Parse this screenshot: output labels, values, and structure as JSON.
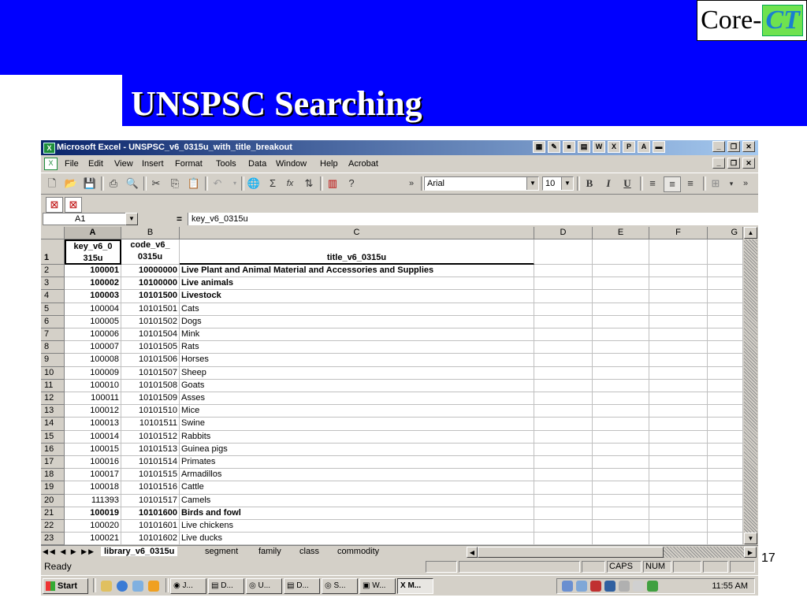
{
  "slide": {
    "title": "UNSPSC Searching",
    "logo_prefix": "Core-",
    "logo_suffix": "CT",
    "page_number": "17",
    "colors": {
      "background": "#0000ff",
      "title": "#ffffff"
    }
  },
  "window": {
    "title": "Microsoft Excel - UNSPSC_v6_0315u_with_title_breakout"
  },
  "menu": [
    "File",
    "Edit",
    "View",
    "Insert",
    "Format",
    "Tools",
    "Data",
    "Window",
    "Help",
    "Acrobat"
  ],
  "toolbar": {
    "font_name": "Arial",
    "font_size": "10",
    "bold": "B",
    "italic": "I",
    "underline": "U",
    "sigma": "Σ",
    "fx": "fx"
  },
  "formula_bar": {
    "name_box": "A1",
    "equals": "=",
    "value": "key_v6_0315u"
  },
  "columns": [
    "A",
    "B",
    "C",
    "D",
    "E",
    "F",
    "G"
  ],
  "header_row": {
    "row": "1",
    "a_line1": "key_v6_0",
    "a_line2": "315u",
    "b_line1": "code_v6_",
    "b_line2": "0315u",
    "c": "title_v6_0315u"
  },
  "rows": [
    {
      "row": "2",
      "key": "100001",
      "code": "10000000",
      "title": "Live Plant and Animal Material and Accessories and Supplies",
      "bold": true
    },
    {
      "row": "3",
      "key": "100002",
      "code": "10100000",
      "title": "Live animals",
      "bold": true
    },
    {
      "row": "4",
      "key": "100003",
      "code": "10101500",
      "title": "Livestock",
      "bold": true
    },
    {
      "row": "5",
      "key": "100004",
      "code": "10101501",
      "title": "Cats",
      "bold": false
    },
    {
      "row": "6",
      "key": "100005",
      "code": "10101502",
      "title": "Dogs",
      "bold": false
    },
    {
      "row": "7",
      "key": "100006",
      "code": "10101504",
      "title": "Mink",
      "bold": false
    },
    {
      "row": "8",
      "key": "100007",
      "code": "10101505",
      "title": "Rats",
      "bold": false
    },
    {
      "row": "9",
      "key": "100008",
      "code": "10101506",
      "title": "Horses",
      "bold": false
    },
    {
      "row": "10",
      "key": "100009",
      "code": "10101507",
      "title": "Sheep",
      "bold": false
    },
    {
      "row": "11",
      "key": "100010",
      "code": "10101508",
      "title": "Goats",
      "bold": false
    },
    {
      "row": "12",
      "key": "100011",
      "code": "10101509",
      "title": "Asses",
      "bold": false
    },
    {
      "row": "13",
      "key": "100012",
      "code": "10101510",
      "title": "Mice",
      "bold": false
    },
    {
      "row": "14",
      "key": "100013",
      "code": "10101511",
      "title": "Swine",
      "bold": false
    },
    {
      "row": "15",
      "key": "100014",
      "code": "10101512",
      "title": "Rabbits",
      "bold": false
    },
    {
      "row": "16",
      "key": "100015",
      "code": "10101513",
      "title": "Guinea pigs",
      "bold": false
    },
    {
      "row": "17",
      "key": "100016",
      "code": "10101514",
      "title": "Primates",
      "bold": false
    },
    {
      "row": "18",
      "key": "100017",
      "code": "10101515",
      "title": "Armadillos",
      "bold": false
    },
    {
      "row": "19",
      "key": "100018",
      "code": "10101516",
      "title": "Cattle",
      "bold": false
    },
    {
      "row": "20",
      "key": "111393",
      "code": "10101517",
      "title": "Camels",
      "bold": false
    },
    {
      "row": "21",
      "key": "100019",
      "code": "10101600",
      "title": "Birds and fowl",
      "bold": true
    },
    {
      "row": "22",
      "key": "100020",
      "code": "10101601",
      "title": "Live chickens",
      "bold": false
    },
    {
      "row": "23",
      "key": "100021",
      "code": "10101602",
      "title": "Live ducks",
      "bold": false
    }
  ],
  "sheet_tabs": [
    "library_v6_0315u",
    "segment",
    "family",
    "class",
    "commodity"
  ],
  "status": {
    "ready": "Ready",
    "caps": "CAPS",
    "num": "NUM"
  },
  "taskbar": {
    "start": "Start",
    "tasks": [
      "J...",
      "D...",
      "U...",
      "D...",
      "S...",
      "W...",
      "M..."
    ],
    "clock": "11:55 AM"
  }
}
